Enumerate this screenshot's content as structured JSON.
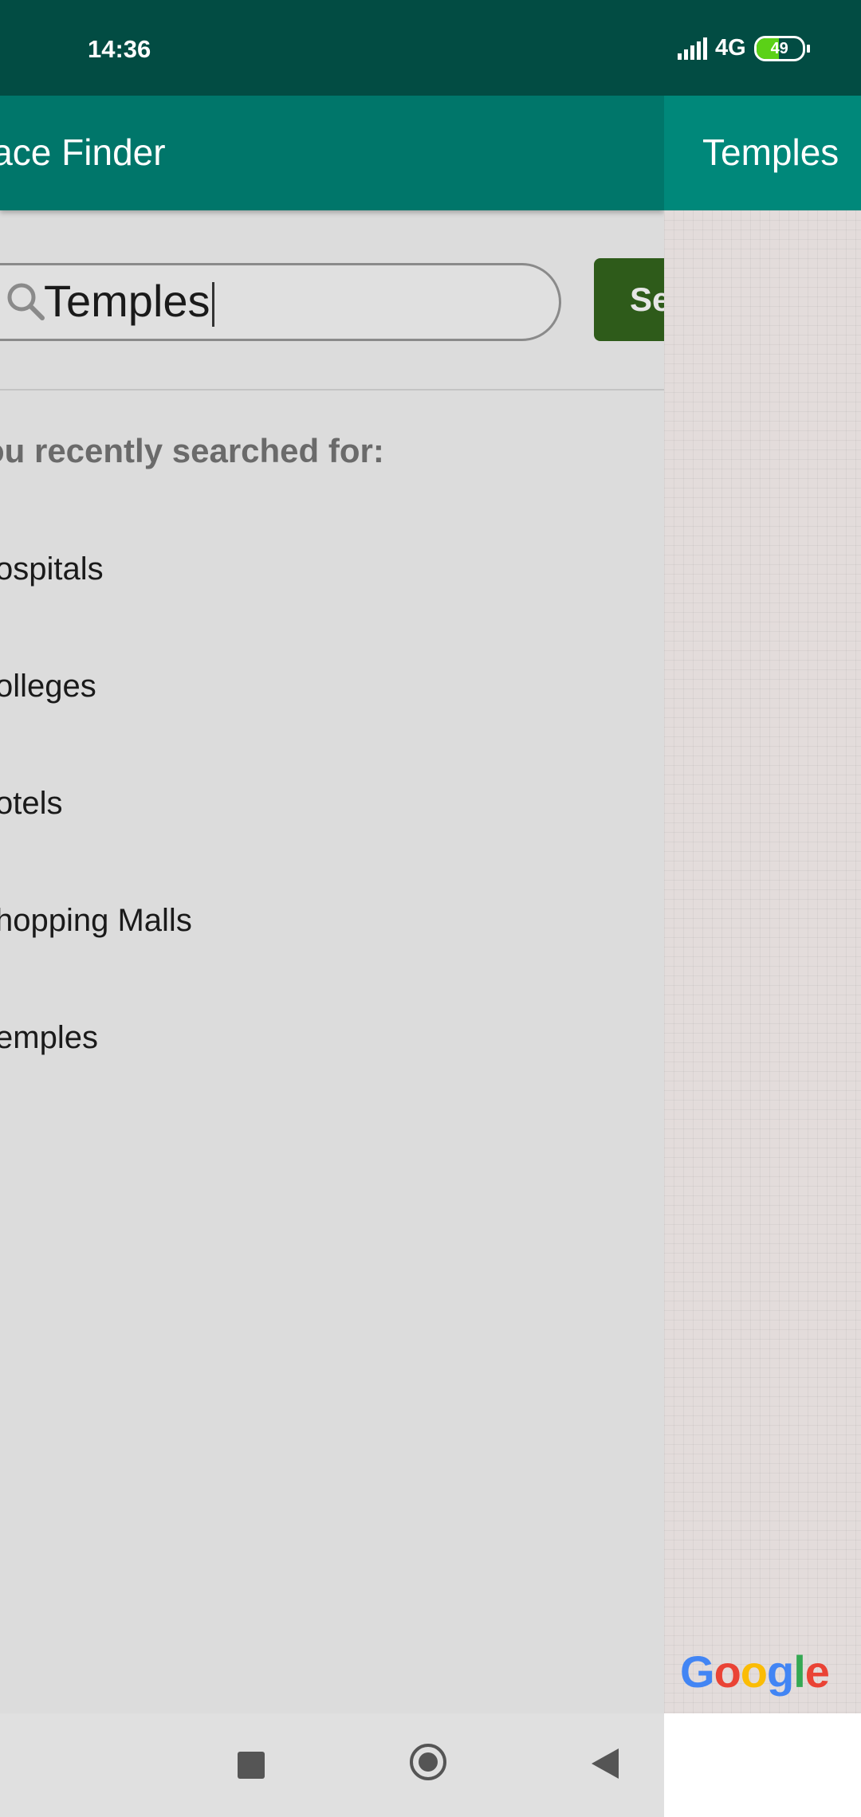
{
  "status_bar": {
    "time": "14:36",
    "network": "4G",
    "battery": "49",
    "battery_level": 0.49
  },
  "drawer": {
    "title": "lace Finder",
    "search": {
      "value": "Temples",
      "button_label": "Se"
    },
    "recent_heading": "ou recently searched for:",
    "recent_items": [
      "ospitals",
      "olleges",
      "otels",
      "hopping Malls",
      "emples"
    ]
  },
  "map_panel": {
    "title": "Temples",
    "google_logo": "Google"
  },
  "nav_bar": {
    "recents_icon": "square-icon",
    "home_icon": "circle-icon",
    "back_icon": "triangle-back-icon"
  },
  "colors": {
    "status_bar": "#024c43",
    "app_bar": "#00766a",
    "search_button": "#2e5b1a"
  }
}
